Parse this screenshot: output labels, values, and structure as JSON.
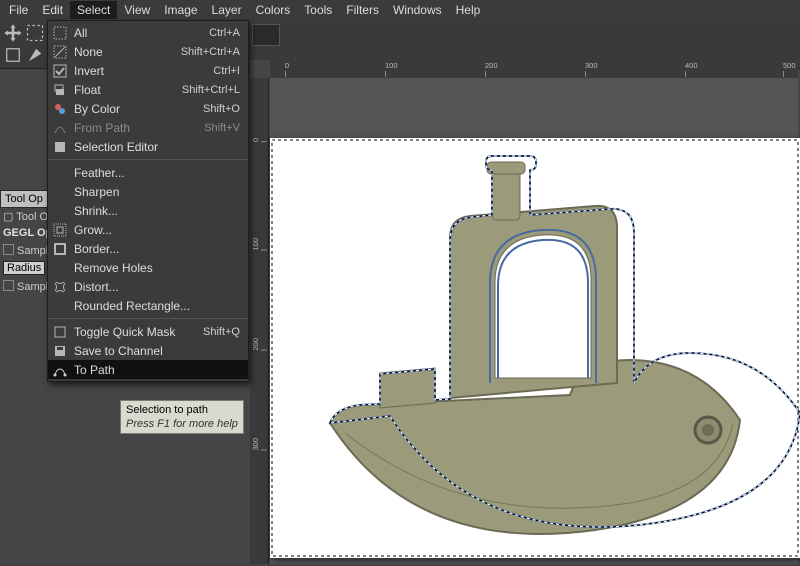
{
  "menubar": {
    "items": [
      "File",
      "Edit",
      "Select",
      "View",
      "Image",
      "Layer",
      "Colors",
      "Tools",
      "Filters",
      "Windows",
      "Help"
    ],
    "open_index": 2
  },
  "select_menu": {
    "rows": [
      {
        "icon": "select-all-icon",
        "label": "All",
        "accel": "Ctrl+A"
      },
      {
        "icon": "select-none-icon",
        "label": "None",
        "accel": "Shift+Ctrl+A"
      },
      {
        "icon": "checkbox-checked-icon",
        "label": "Invert",
        "accel": "Ctrl+I"
      },
      {
        "icon": "float-icon",
        "label": "Float",
        "accel": "Shift+Ctrl+L"
      },
      {
        "icon": "by-color-icon",
        "label": "By Color",
        "accel": "Shift+O"
      },
      {
        "icon": "from-path-icon",
        "label": "From Path",
        "accel": "Shift+V",
        "disabled": true
      },
      {
        "icon": "selection-editor-icon",
        "label": "Selection Editor",
        "accel": ""
      },
      {
        "sep": true
      },
      {
        "icon": "",
        "label": "Feather...",
        "accel": ""
      },
      {
        "icon": "",
        "label": "Sharpen",
        "accel": ""
      },
      {
        "icon": "",
        "label": "Shrink...",
        "accel": ""
      },
      {
        "icon": "grow-icon",
        "label": "Grow...",
        "accel": ""
      },
      {
        "icon": "border-icon",
        "label": "Border...",
        "accel": ""
      },
      {
        "icon": "",
        "label": "Remove Holes",
        "accel": ""
      },
      {
        "icon": "distort-icon",
        "label": "Distort...",
        "accel": ""
      },
      {
        "icon": "",
        "label": "Rounded Rectangle...",
        "accel": ""
      },
      {
        "sep": true
      },
      {
        "icon": "checkbox-icon",
        "label": "Toggle Quick Mask",
        "accel": "Shift+Q"
      },
      {
        "icon": "save-channel-icon",
        "label": "Save to Channel",
        "accel": ""
      },
      {
        "icon": "to-path-icon",
        "label": "To Path",
        "accel": "",
        "highlight": true
      }
    ]
  },
  "tooltip": {
    "title": "Selection to path",
    "help": "Press F1 for more help"
  },
  "left_dock": {
    "tab1": "Tool Op",
    "line_toolopts": "Tool Op",
    "gegl": "GEGL Op",
    "sample": "Sample",
    "radius_label": "Radius",
    "sample2": "Sample"
  },
  "ruler_h_ticks": [
    "0",
    "100",
    "200",
    "300",
    "400",
    "500"
  ],
  "ruler_v_ticks": [
    "0",
    "100",
    "200",
    "300"
  ],
  "colors": {
    "benchy_fill": "#9b9b7c",
    "benchy_stroke": "#8a8a6a",
    "selection": "#4a6a9f"
  },
  "tool_icons": [
    "move-tool-icon",
    "rect-select-icon",
    "marquee-icon",
    "fuzzy-select-icon"
  ]
}
